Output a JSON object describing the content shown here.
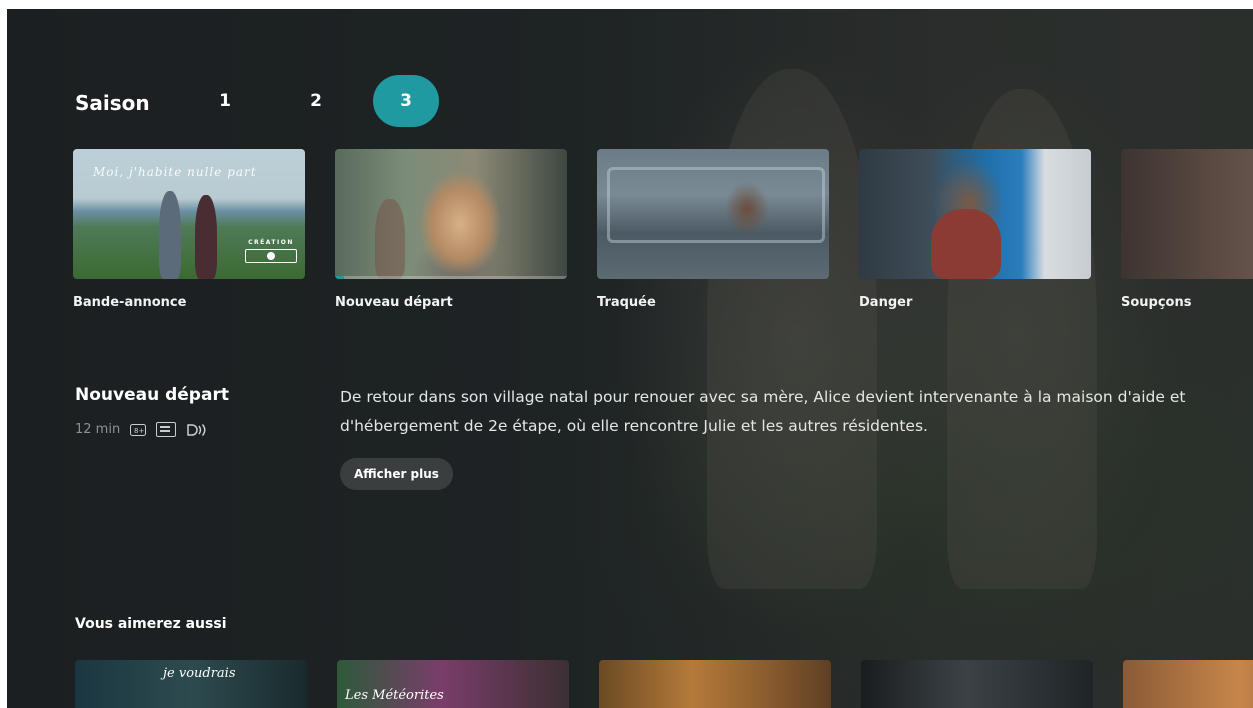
{
  "season": {
    "label": "Saison",
    "tabs": [
      "1",
      "2",
      "3"
    ],
    "active": "3"
  },
  "episodes": [
    {
      "title": "Bande-annonce",
      "thumb_text": "Moi, j'habite nulle part",
      "badge": "CRÉATION"
    },
    {
      "title": "Nouveau départ",
      "progress": 0.04
    },
    {
      "title": "Traquée"
    },
    {
      "title": "Danger"
    },
    {
      "title": "Soupçons"
    }
  ],
  "details": {
    "title": "Nouveau départ",
    "duration": "12 min",
    "description": "De retour dans son village natal pour renouer avec sa mère, Alice devient intervenante à la maison d'aide et d'hébergement de 2e étape, où elle rencontre Julie et les autres résidentes.",
    "more_label": "Afficher plus",
    "icons": [
      "rating-icon",
      "closed-captions-icon",
      "audio-description-icon"
    ]
  },
  "recommended": {
    "title": "Vous aimerez aussi",
    "items": [
      {
        "text": "je voudrais"
      },
      {
        "text": "Les Météorites"
      },
      {
        "text": ""
      },
      {
        "text": ""
      },
      {
        "text": ""
      }
    ]
  },
  "colors": {
    "accent": "#1e9aa0",
    "background": "#1e2324"
  }
}
